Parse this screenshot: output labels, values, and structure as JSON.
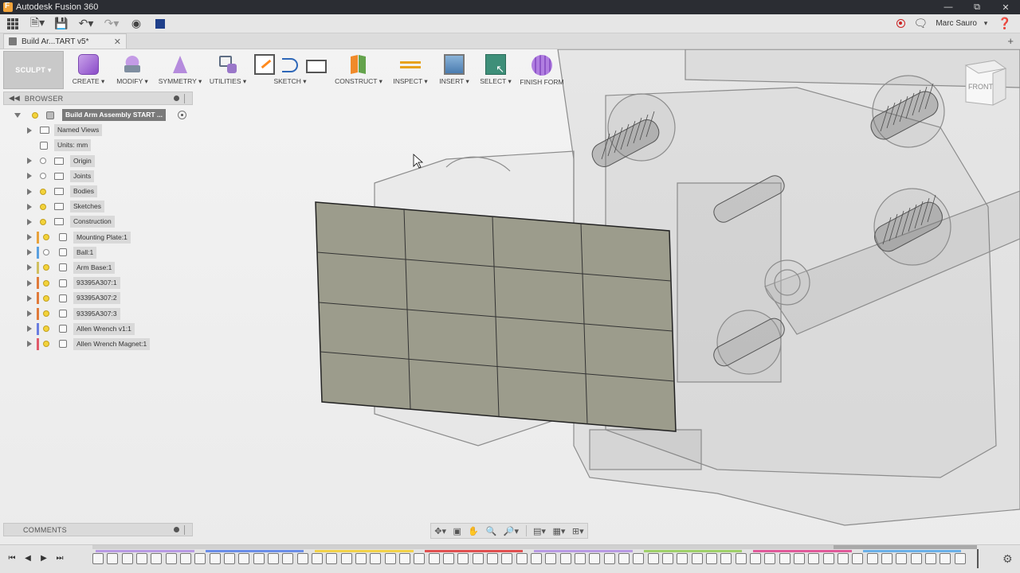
{
  "window": {
    "title": "Autodesk Fusion 360",
    "controls": [
      "minimize",
      "restore",
      "close"
    ]
  },
  "quick_access": {
    "user": "Marc Sauro",
    "icons": [
      "apps-grid-icon",
      "file-icon",
      "save-icon",
      "undo-icon",
      "redo-icon",
      "data-panel-icon",
      "extension-icon"
    ]
  },
  "document_tab": {
    "label": "Build Ar...TART v5*"
  },
  "toolbar": {
    "workspace": "SCULPT",
    "groups": [
      {
        "id": "create",
        "label": "CREATE"
      },
      {
        "id": "modify",
        "label": "MODIFY"
      },
      {
        "id": "symmetry",
        "label": "SYMMETRY"
      },
      {
        "id": "utilities",
        "label": "UTILITIES"
      },
      {
        "id": "sketch",
        "label": "SKETCH"
      },
      {
        "id": "construct",
        "label": "CONSTRUCT"
      },
      {
        "id": "inspect",
        "label": "INSPECT"
      },
      {
        "id": "insert",
        "label": "INSERT"
      },
      {
        "id": "select",
        "label": "SELECT"
      },
      {
        "id": "finish",
        "label": "FINISH FORM"
      }
    ]
  },
  "browser": {
    "header": "BROWSER",
    "root": "Build Arm Assembly START ...",
    "items": [
      {
        "label": "Named Views",
        "type": "folder",
        "expand": true,
        "bulb": false
      },
      {
        "label": "Units: mm",
        "type": "units",
        "expand": false,
        "bulb": false
      },
      {
        "label": "Origin",
        "type": "folder",
        "expand": true,
        "bulb": "off"
      },
      {
        "label": "Joints",
        "type": "folder",
        "expand": true,
        "bulb": "off"
      },
      {
        "label": "Bodies",
        "type": "folder",
        "expand": true,
        "bulb": "on"
      },
      {
        "label": "Sketches",
        "type": "folder",
        "expand": true,
        "bulb": "on"
      },
      {
        "label": "Construction",
        "type": "folder",
        "expand": true,
        "bulb": "on"
      },
      {
        "label": "Mounting Plate:1",
        "type": "component",
        "expand": true,
        "bulb": "on",
        "color": "#e8a23c"
      },
      {
        "label": "Ball:1",
        "type": "component",
        "expand": true,
        "bulb": "off",
        "color": "#5aa0e0"
      },
      {
        "label": "Arm Base:1",
        "type": "component",
        "expand": true,
        "bulb": "on",
        "color": "#d0c060"
      },
      {
        "label": "93395A307:1",
        "type": "component",
        "expand": true,
        "bulb": "on",
        "color": "#e07a3a"
      },
      {
        "label": "93395A307:2",
        "type": "component",
        "expand": true,
        "bulb": "on",
        "color": "#e07a3a"
      },
      {
        "label": "93395A307:3",
        "type": "component",
        "expand": true,
        "bulb": "on",
        "color": "#e07a3a"
      },
      {
        "label": "Allen Wrench v1:1",
        "type": "component",
        "expand": true,
        "bulb": "on",
        "color": "#6a7de0"
      },
      {
        "label": "Allen Wrench Magnet:1",
        "type": "component",
        "expand": true,
        "bulb": "on",
        "color": "#e05a6a"
      }
    ]
  },
  "comments": {
    "header": "COMMENTS"
  },
  "viewcube": {
    "label": "FRONT"
  },
  "navbar": {
    "icons": [
      "orbit-icon",
      "look-at-icon",
      "pan-icon",
      "zoom-icon",
      "zoom-window-icon",
      "display-settings-icon",
      "grid-settings-icon",
      "viewports-icon"
    ]
  },
  "timeline": {
    "controls": [
      "go-to-start",
      "step-back",
      "play",
      "go-to-end"
    ],
    "bar_colors": [
      "#b89ae3",
      "#6a8de8",
      "#f2d24a",
      "#e05050",
      "#b89ae3",
      "#9fd06a",
      "#e05a9a",
      "#6ab0e8"
    ],
    "item_count": 60
  },
  "colors": {
    "titlebar": "#2b2d33",
    "accent_sculpt": "#8a4cc8",
    "plate": "#9a9a8a"
  }
}
